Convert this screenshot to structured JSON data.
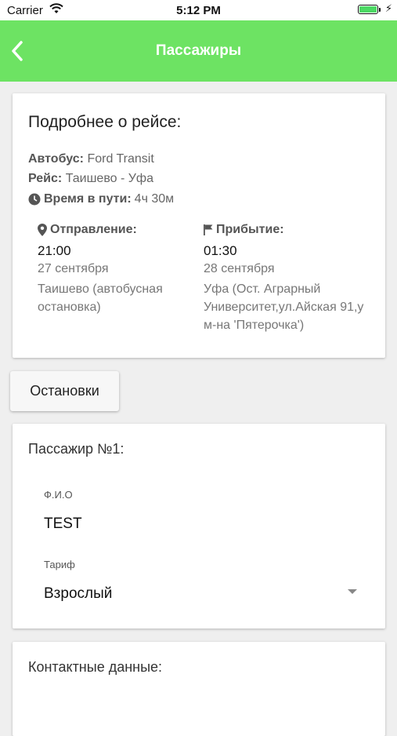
{
  "status_bar": {
    "carrier": "Carrier",
    "time": "5:12 PM"
  },
  "app_bar": {
    "title": "Пассажиры",
    "back_icon": "chevron-left-icon"
  },
  "trip": {
    "title": "Подробнее о рейсе:",
    "bus_label": "Автобус:",
    "bus_value": "Ford Transit",
    "route_label": "Рейс:",
    "route_value": "Таишево - Уфа",
    "duration_label": "Время в пути:",
    "duration_value": "4ч 30м",
    "departure": {
      "label": "Отправление:",
      "time": "21:00",
      "date": "27 сентября",
      "place": "Таишево (автобусная остановка)"
    },
    "arrival": {
      "label": "Прибытие:",
      "time": "01:30",
      "date": "28 сентября",
      "place": "Уфа (Ост. Аграрный Университет,ул.Айская 91,у м-на 'Пятерочка')"
    }
  },
  "stops_button": {
    "label": "Остановки"
  },
  "passenger": {
    "title": "Пассажир №1:",
    "fio_label": "Ф.И.О",
    "fio_value": "TEST",
    "tariff_label": "Тариф",
    "tariff_value": "Взрослый"
  },
  "contact": {
    "title": "Контактные данные:"
  },
  "colors": {
    "app_bar": "#6de363",
    "background": "#efefef"
  }
}
